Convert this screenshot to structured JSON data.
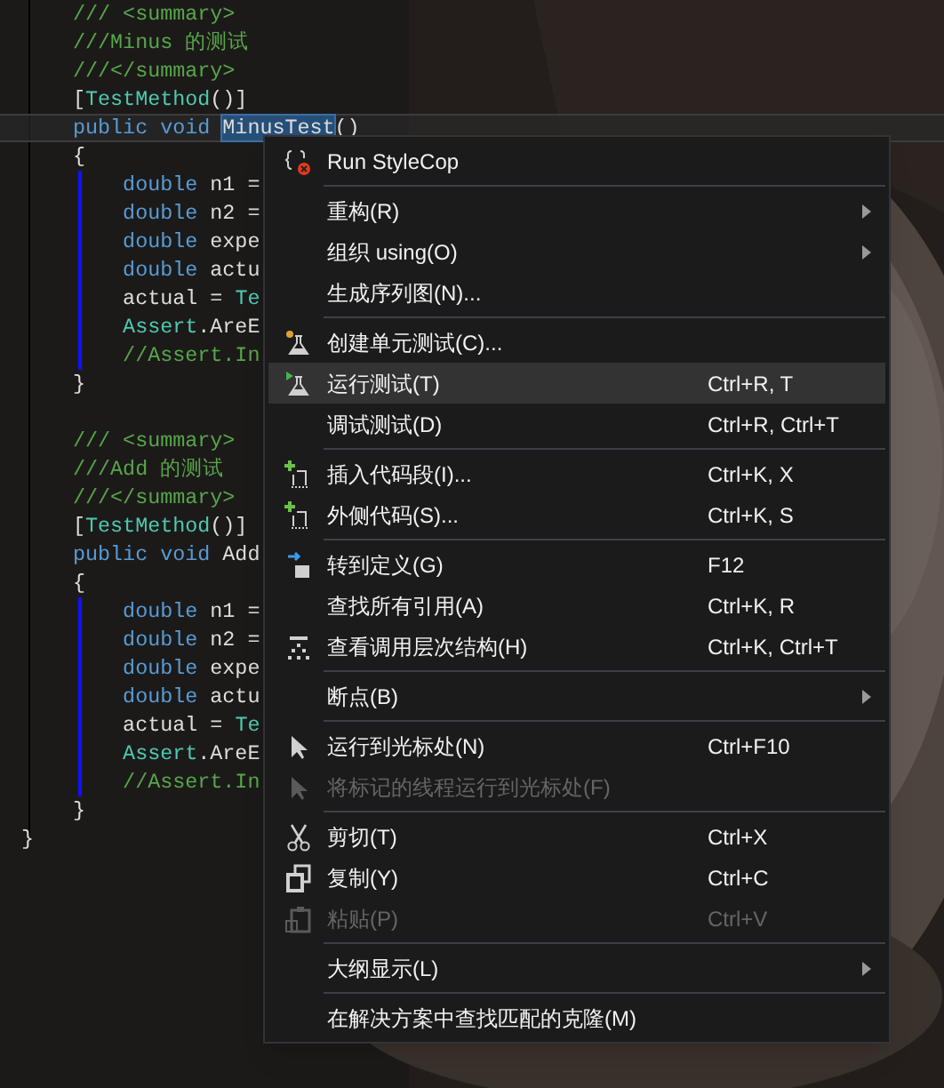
{
  "code_lines": [
    {
      "changed": false,
      "current": false,
      "segments": [
        {
          "kind": "comment",
          "text": "/// <summary>"
        }
      ]
    },
    {
      "changed": false,
      "current": false,
      "segments": [
        {
          "kind": "comment",
          "text": "///Minus 的测试"
        }
      ]
    },
    {
      "changed": false,
      "current": false,
      "segments": [
        {
          "kind": "comment",
          "text": "///</summary>"
        }
      ]
    },
    {
      "changed": false,
      "current": false,
      "segments": [
        {
          "kind": "plain",
          "text": "["
        },
        {
          "kind": "type",
          "text": "TestMethod"
        },
        {
          "kind": "plain",
          "text": "()]"
        }
      ]
    },
    {
      "changed": false,
      "current": true,
      "segments": [
        {
          "kind": "keyword",
          "text": "public void "
        },
        {
          "kind": "selected",
          "text": "MinusTest"
        },
        {
          "kind": "plain",
          "text": "()"
        }
      ]
    },
    {
      "changed": false,
      "current": false,
      "segments": [
        {
          "kind": "plain",
          "text": "{"
        }
      ]
    },
    {
      "changed": true,
      "current": false,
      "segments": [
        {
          "kind": "keyword",
          "text": "    double"
        },
        {
          "kind": "plain",
          "text": " n1 ="
        }
      ]
    },
    {
      "changed": true,
      "current": false,
      "segments": [
        {
          "kind": "keyword",
          "text": "    double"
        },
        {
          "kind": "plain",
          "text": " n2 ="
        }
      ]
    },
    {
      "changed": true,
      "current": false,
      "segments": [
        {
          "kind": "keyword",
          "text": "    double"
        },
        {
          "kind": "plain",
          "text": " expe"
        }
      ]
    },
    {
      "changed": true,
      "current": false,
      "segments": [
        {
          "kind": "keyword",
          "text": "    double"
        },
        {
          "kind": "plain",
          "text": " actu"
        }
      ]
    },
    {
      "changed": true,
      "current": false,
      "segments": [
        {
          "kind": "plain",
          "text": "    actual = "
        },
        {
          "kind": "type",
          "text": "Te"
        }
      ]
    },
    {
      "changed": true,
      "current": false,
      "segments": [
        {
          "kind": "type",
          "text": "    Assert"
        },
        {
          "kind": "plain",
          "text": ".AreE"
        }
      ]
    },
    {
      "changed": true,
      "current": false,
      "segments": [
        {
          "kind": "comment",
          "text": "    //Assert.In"
        }
      ]
    },
    {
      "changed": false,
      "current": false,
      "segments": [
        {
          "kind": "plain",
          "text": "}"
        }
      ]
    },
    {
      "changed": false,
      "current": false
    },
    {
      "changed": false,
      "current": false,
      "segments": [
        {
          "kind": "comment",
          "text": "/// <summary>"
        }
      ]
    },
    {
      "changed": false,
      "current": false,
      "segments": [
        {
          "kind": "comment",
          "text": "///Add 的测试"
        }
      ]
    },
    {
      "changed": false,
      "current": false,
      "segments": [
        {
          "kind": "comment",
          "text": "///</summary>"
        }
      ]
    },
    {
      "changed": false,
      "current": false,
      "segments": [
        {
          "kind": "plain",
          "text": "["
        },
        {
          "kind": "type",
          "text": "TestMethod"
        },
        {
          "kind": "plain",
          "text": "()]"
        }
      ]
    },
    {
      "changed": false,
      "current": false,
      "segments": [
        {
          "kind": "keyword",
          "text": "public void "
        },
        {
          "kind": "plain",
          "text": "Add"
        }
      ]
    },
    {
      "changed": false,
      "current": false,
      "segments": [
        {
          "kind": "plain",
          "text": "{"
        }
      ]
    },
    {
      "changed": true,
      "current": false,
      "segments": [
        {
          "kind": "keyword",
          "text": "    double"
        },
        {
          "kind": "plain",
          "text": " n1 ="
        }
      ]
    },
    {
      "changed": true,
      "current": false,
      "segments": [
        {
          "kind": "keyword",
          "text": "    double"
        },
        {
          "kind": "plain",
          "text": " n2 ="
        }
      ]
    },
    {
      "changed": true,
      "current": false,
      "segments": [
        {
          "kind": "keyword",
          "text": "    double"
        },
        {
          "kind": "plain",
          "text": " expe"
        }
      ]
    },
    {
      "changed": true,
      "current": false,
      "segments": [
        {
          "kind": "keyword",
          "text": "    double"
        },
        {
          "kind": "plain",
          "text": " actu"
        }
      ]
    },
    {
      "changed": true,
      "current": false,
      "segments": [
        {
          "kind": "plain",
          "text": "    actual = "
        },
        {
          "kind": "type",
          "text": "Te"
        }
      ]
    },
    {
      "changed": true,
      "current": false,
      "segments": [
        {
          "kind": "type",
          "text": "    Assert"
        },
        {
          "kind": "plain",
          "text": ".AreE"
        }
      ]
    },
    {
      "changed": true,
      "current": false,
      "segments": [
        {
          "kind": "comment",
          "text": "    //Assert.In"
        }
      ]
    },
    {
      "changed": false,
      "current": false,
      "segments": [
        {
          "kind": "plain",
          "text": "}"
        }
      ]
    },
    {
      "changed": false,
      "current": false,
      "outdent": true,
      "segments": [
        {
          "kind": "plain",
          "text": "}"
        }
      ]
    }
  ],
  "context_menu": [
    {
      "kind": "stylecop",
      "label": "Run StyleCop",
      "submenu": false,
      "disabled": false,
      "selected": false
    },
    {
      "kind": "separator"
    },
    {
      "kind": "plain",
      "label": "重构(R)",
      "submenu": true,
      "disabled": false,
      "selected": false
    },
    {
      "kind": "plain",
      "label": "组织 using(O)",
      "submenu": true,
      "disabled": false,
      "selected": false
    },
    {
      "kind": "plain",
      "label": "生成序列图(N)...",
      "submenu": false,
      "disabled": false,
      "selected": false
    },
    {
      "kind": "separator"
    },
    {
      "kind": "newtest",
      "label": "创建单元测试(C)...",
      "submenu": false,
      "disabled": false,
      "selected": false
    },
    {
      "kind": "runtest",
      "label": "运行测试(T)",
      "shortcut": "Ctrl+R, T",
      "submenu": false,
      "disabled": false,
      "selected": true
    },
    {
      "kind": "plain",
      "label": "调试测试(D)",
      "shortcut": "Ctrl+R, Ctrl+T",
      "submenu": false,
      "disabled": false,
      "selected": false
    },
    {
      "kind": "separator"
    },
    {
      "kind": "snippet",
      "label": "插入代码段(I)...",
      "shortcut": "Ctrl+K, X",
      "submenu": false,
      "disabled": false,
      "selected": false
    },
    {
      "kind": "snippet",
      "label": "外侧代码(S)...",
      "shortcut": "Ctrl+K, S",
      "submenu": false,
      "disabled": false,
      "selected": false
    },
    {
      "kind": "separator"
    },
    {
      "kind": "goto",
      "label": "转到定义(G)",
      "shortcut": "F12",
      "submenu": false,
      "disabled": false,
      "selected": false
    },
    {
      "kind": "plain",
      "label": "查找所有引用(A)",
      "shortcut": "Ctrl+K, R",
      "submenu": false,
      "disabled": false,
      "selected": false
    },
    {
      "kind": "hierarchy",
      "label": "查看调用层次结构(H)",
      "shortcut": "Ctrl+K, Ctrl+T",
      "submenu": false,
      "disabled": false,
      "selected": false
    },
    {
      "kind": "separator"
    },
    {
      "kind": "plain",
      "label": "断点(B)",
      "submenu": true,
      "disabled": false,
      "selected": false
    },
    {
      "kind": "separator"
    },
    {
      "kind": "pointer",
      "label": "运行到光标处(N)",
      "shortcut": "Ctrl+F10",
      "submenu": false,
      "disabled": false,
      "selected": false
    },
    {
      "kind": "pointer",
      "label": "将标记的线程运行到光标处(F)",
      "submenu": false,
      "disabled": true,
      "selected": false
    },
    {
      "kind": "separator"
    },
    {
      "kind": "scissors",
      "label": "剪切(T)",
      "shortcut": "Ctrl+X",
      "submenu": false,
      "disabled": false,
      "selected": false
    },
    {
      "kind": "copy",
      "label": "复制(Y)",
      "shortcut": "Ctrl+C",
      "submenu": false,
      "disabled": false,
      "selected": false
    },
    {
      "kind": "paste",
      "label": "粘贴(P)",
      "shortcut": "Ctrl+V",
      "submenu": false,
      "disabled": true,
      "selected": false
    },
    {
      "kind": "separator"
    },
    {
      "kind": "plain",
      "label": "大纲显示(L)",
      "submenu": true,
      "disabled": false,
      "selected": false
    },
    {
      "kind": "separator"
    },
    {
      "kind": "plain",
      "label": "在解决方案中查找匹配的克隆(M)",
      "submenu": false,
      "disabled": false,
      "selected": false
    }
  ]
}
